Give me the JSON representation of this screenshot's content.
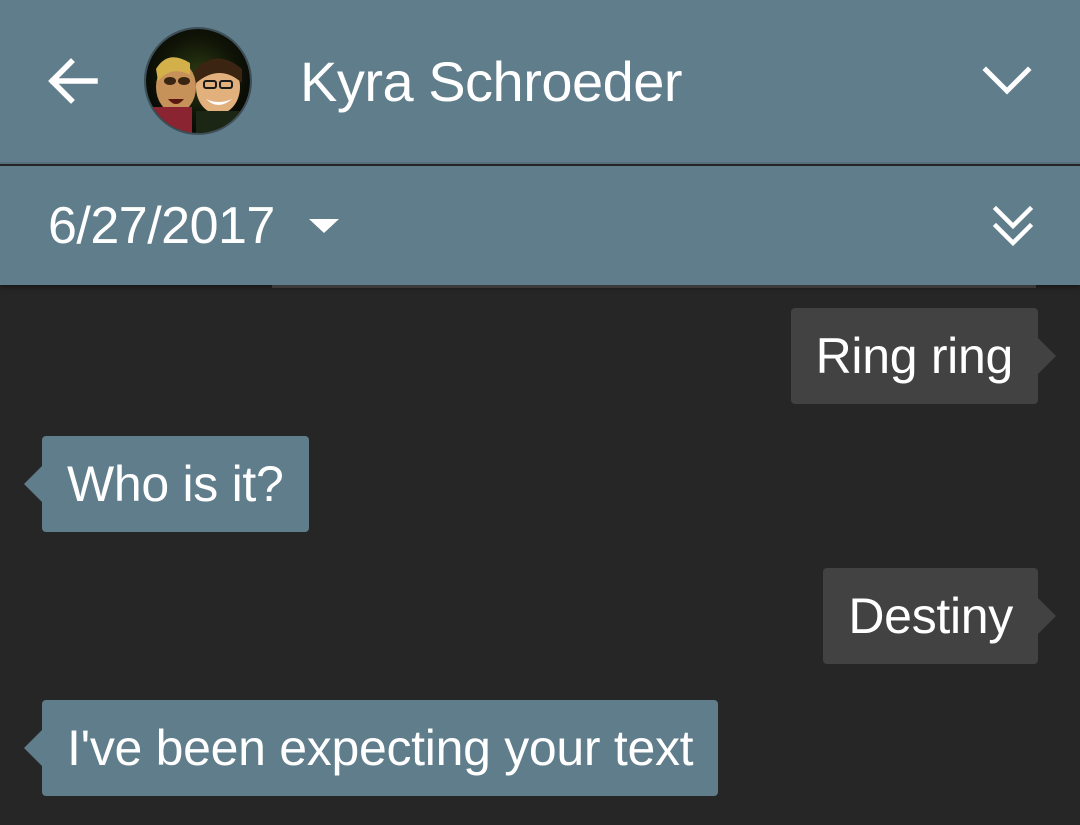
{
  "header": {
    "contact_name": "Kyra Schroeder",
    "back_icon": "arrow-left-icon",
    "expand_icon": "chevron-down-icon",
    "background_color": "#607d8b"
  },
  "datebar": {
    "date": "6/27/2017",
    "dropdown_icon": "caret-down-icon",
    "jump_icon": "double-chevron-down-icon"
  },
  "messages": [
    {
      "text": "Ring ring",
      "direction": "outgoing",
      "color": "#424242"
    },
    {
      "text": "Who is it?",
      "direction": "incoming",
      "color": "#607d8b"
    },
    {
      "text": "Destiny",
      "direction": "outgoing",
      "color": "#424242"
    },
    {
      "text": "I've been expecting your text",
      "direction": "incoming",
      "color": "#607d8b"
    }
  ],
  "background_color": "#262626"
}
